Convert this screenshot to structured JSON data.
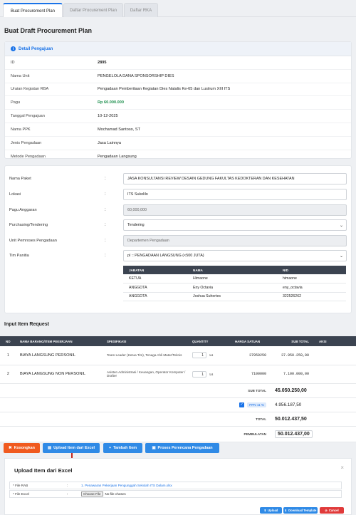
{
  "tabs": [
    {
      "label": "Buat Procurement Plan",
      "active": true
    },
    {
      "label": "Daftar Procurement Plan",
      "active": false
    },
    {
      "label": "Daftar RKA",
      "active": false
    }
  ],
  "page_title": "Buat Draft Procurement Plan",
  "detail": {
    "header_label": "Detail Pengajuan",
    "rows": [
      {
        "label": "ID",
        "value": "2895"
      },
      {
        "label": "Nama Unit",
        "value": "PENGELOLA DANA SPONSORSHIP DIES"
      },
      {
        "label": "Uraian Kegiatan RBA",
        "value": "Pengadaan Pemberitaan Kegiatan Dies Natalis Ke-65 dan Lustrum XIII ITS"
      },
      {
        "label": "Pagu",
        "value": "Rp 60.000.000"
      },
      {
        "label": "Tanggal Pengajuan",
        "value": "10-12-2025"
      },
      {
        "label": "Nama PPK",
        "value": "Mochamad Santoso, ST"
      },
      {
        "label": "Jenis Pengadaan",
        "value": "Jasa Lainnya"
      },
      {
        "label": "Metode Pengadaan",
        "value": "Pengadaan Langsung"
      }
    ]
  },
  "form": {
    "nama_paket": {
      "label": "Nama Paket",
      "value": "JASA KONSULTANSI REVIEW DESAIN GEDUNG FAKULTAS KEDOKTERAN DAN KESEHATAN"
    },
    "lokasi": {
      "label": "Lokasi",
      "value": "ITS Sukolilo"
    },
    "pagu_anggaran": {
      "label": "Pagu Anggaran",
      "value": "60,000,000"
    },
    "purchasing": {
      "label": "Purchasing/Tendering",
      "value": "Tendering"
    },
    "unit_pemroses": {
      "label": "Unit Pemroses Pengadaan",
      "value": "Departemen Pengadaan"
    },
    "tim_panitia": {
      "label": "Tim Panitia",
      "value": "pl :: PENGADAAN LANGSUNG (<500 JUTA)"
    },
    "colon": ":"
  },
  "panitia": {
    "headers": [
      "JABATAN",
      "NAMA",
      "NID"
    ],
    "rows": [
      [
        "KETUA",
        "Himaone",
        "himaone"
      ],
      [
        "ANGGOTA",
        "Eny Octavia",
        "eny_octavia"
      ],
      [
        "ANGGOTA",
        "Joshua Suhertes",
        "322526262"
      ]
    ]
  },
  "items_section_title": "Input Item Request",
  "items": {
    "headers": [
      "NO",
      "NAMA BARANG/ITEM PEKERJAAN",
      "SPESIFIKASI",
      "QUANTITY",
      "HARGA SATUAN",
      "SUB TOTAL",
      "AKSI"
    ],
    "rows": [
      {
        "no": "1",
        "nama": "BIAYA LANGSUNG PERSONIL",
        "spesifikasi": "Team Leader (Ketua Tim), Tenaga Ahli Mater/Teknis",
        "qty": "1",
        "unit": "Ls",
        "harga": "37950250",
        "subtotal": "37.950.250,00"
      },
      {
        "no": "2",
        "nama": "BIAYA LANGSUNG NON PERSONIL",
        "spesifikasi": "Asisten Administrasi / Keuangan, Operator Komputer / Drafter",
        "qty": "1",
        "unit": "Ls",
        "harga": "7100000",
        "subtotal": "7.100.000,00"
      }
    ],
    "sub_total_label": "SUB TOTAL",
    "sub_total": "45.050.250,00",
    "ppn_label": "PPN 11 %",
    "ppn_value": "4.956.187,50",
    "total_label": "TOTAL",
    "total": "50.012.437,50",
    "pembulatan_label": "PEMBULATAN",
    "pembulatan": "50.012.437,00"
  },
  "buttons": {
    "kosongkan": "Kosongkan",
    "upload_excel": "Upload Item dari Excel",
    "tambah_item": "Tambah Item",
    "proses": "Proses Perencana Pengadaan"
  },
  "modal": {
    "title": "Upload Item dari Excel",
    "file_rab_label": "* File RAB",
    "file_rab_link": "1. Penawaran Pekerjaan Pengunggah Sekolah ITS Dalam.xlsx",
    "file_excel_label": "* File Excel",
    "choose_file": "Choose File",
    "no_file": "No file chosen",
    "sep": ":",
    "upload_btn": "Upload",
    "download_template_btn": "Download Template",
    "cancel_btn": "Cancel",
    "close": "×"
  },
  "colors": {
    "accent": "#1a73e8",
    "orange": "#f05a1f",
    "header_dark": "#3b4350",
    "pagu_green": "#1e8f4e",
    "arrow_red": "#c0261f"
  }
}
